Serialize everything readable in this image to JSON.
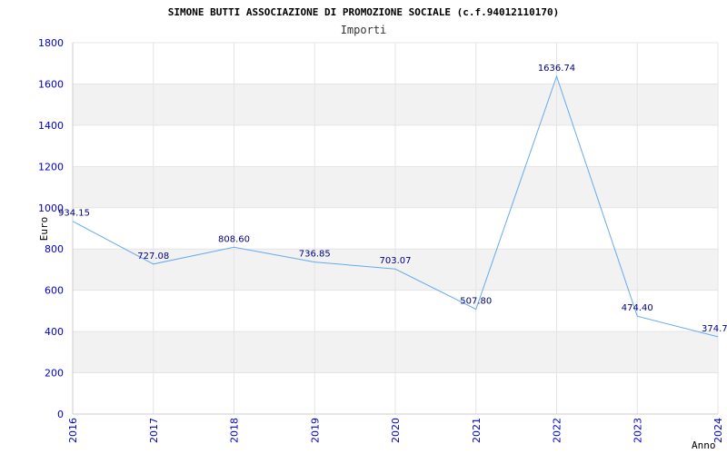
{
  "chart_data": {
    "type": "line",
    "title": "SIMONE BUTTI ASSOCIAZIONE DI PROMOZIONE SOCIALE (c.f.94012110170)",
    "subtitle": "Importi",
    "xlabel": "Anno",
    "ylabel": "Euro",
    "categories": [
      "2016",
      "2017",
      "2018",
      "2019",
      "2020",
      "2021",
      "2022",
      "2023",
      "2024"
    ],
    "values": [
      934.15,
      727.08,
      808.6,
      736.85,
      703.07,
      507.8,
      1636.74,
      474.4,
      374.7
    ],
    "value_labels": [
      "934.15",
      "727.08",
      "808.60",
      "736.85",
      "703.07",
      "507.80",
      "1636.74",
      "474.40",
      "374.7"
    ],
    "ylim": [
      0,
      1800
    ],
    "yticks": [
      "0",
      "200",
      "400",
      "600",
      "800",
      "1000",
      "1200",
      "1400",
      "1600",
      "1800"
    ],
    "grid": true,
    "colors": {
      "line": "#66aaee",
      "band": "#f2f2f2",
      "tick_text": "#0000cc",
      "value_text": "#000080"
    }
  }
}
